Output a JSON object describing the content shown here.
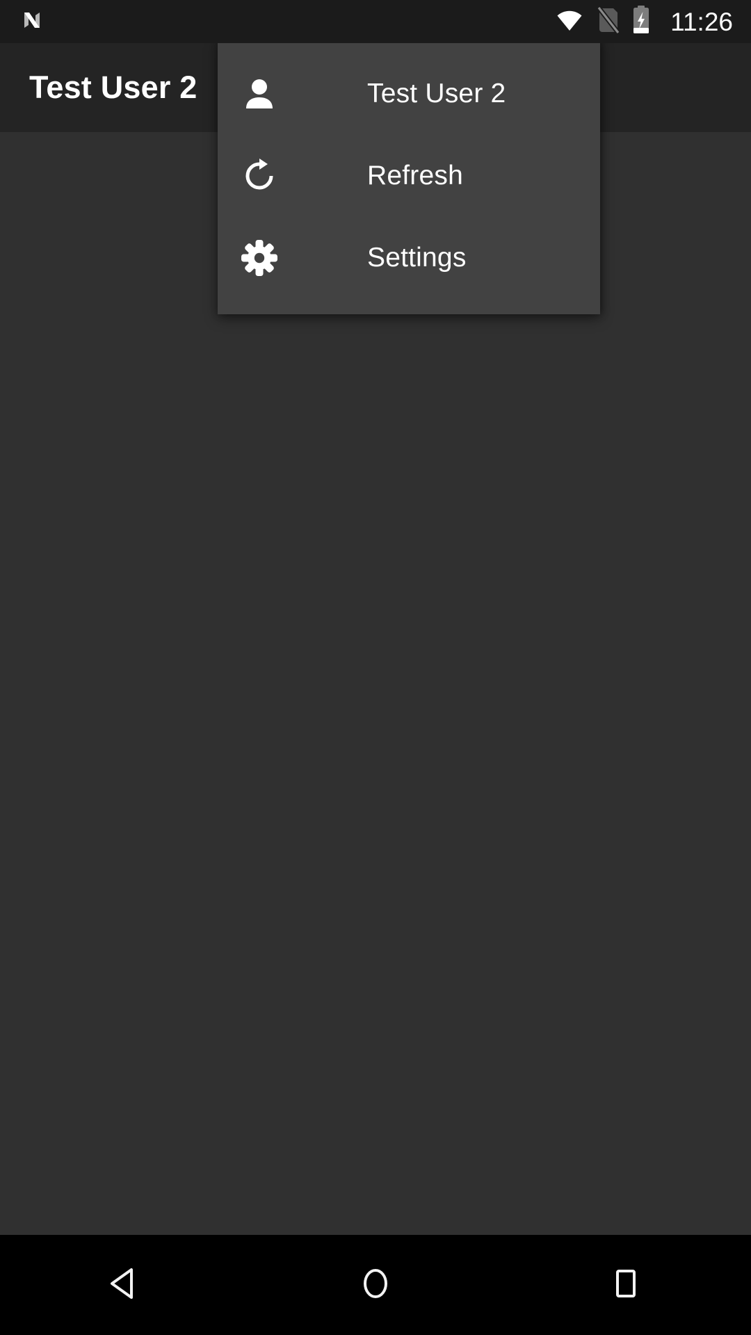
{
  "status_bar": {
    "android_logo_icon": "android-n-logo-icon",
    "wifi_icon": "wifi-full-icon",
    "sim_icon": "sim-card-off-icon",
    "battery_icon": "battery-charging-icon",
    "clock": "11:26"
  },
  "app_bar": {
    "title": "Test User 2"
  },
  "popup_menu": {
    "items": [
      {
        "label": "Test User 2",
        "icon": "person-icon"
      },
      {
        "label": "Refresh",
        "icon": "refresh-icon"
      },
      {
        "label": "Settings",
        "icon": "gear-icon"
      }
    ]
  },
  "nav_bar": {
    "back_icon": "back-triangle-icon",
    "home_icon": "home-circle-icon",
    "recents_icon": "recents-square-icon"
  },
  "colors": {
    "status_bar_bg": "#1b1b1b",
    "app_bar_bg": "#242424",
    "content_bg": "#303030",
    "menu_bg": "#424242",
    "nav_bar_bg": "#000000",
    "text_primary": "#ffffff",
    "icon_inactive": "#5a5a5a"
  }
}
